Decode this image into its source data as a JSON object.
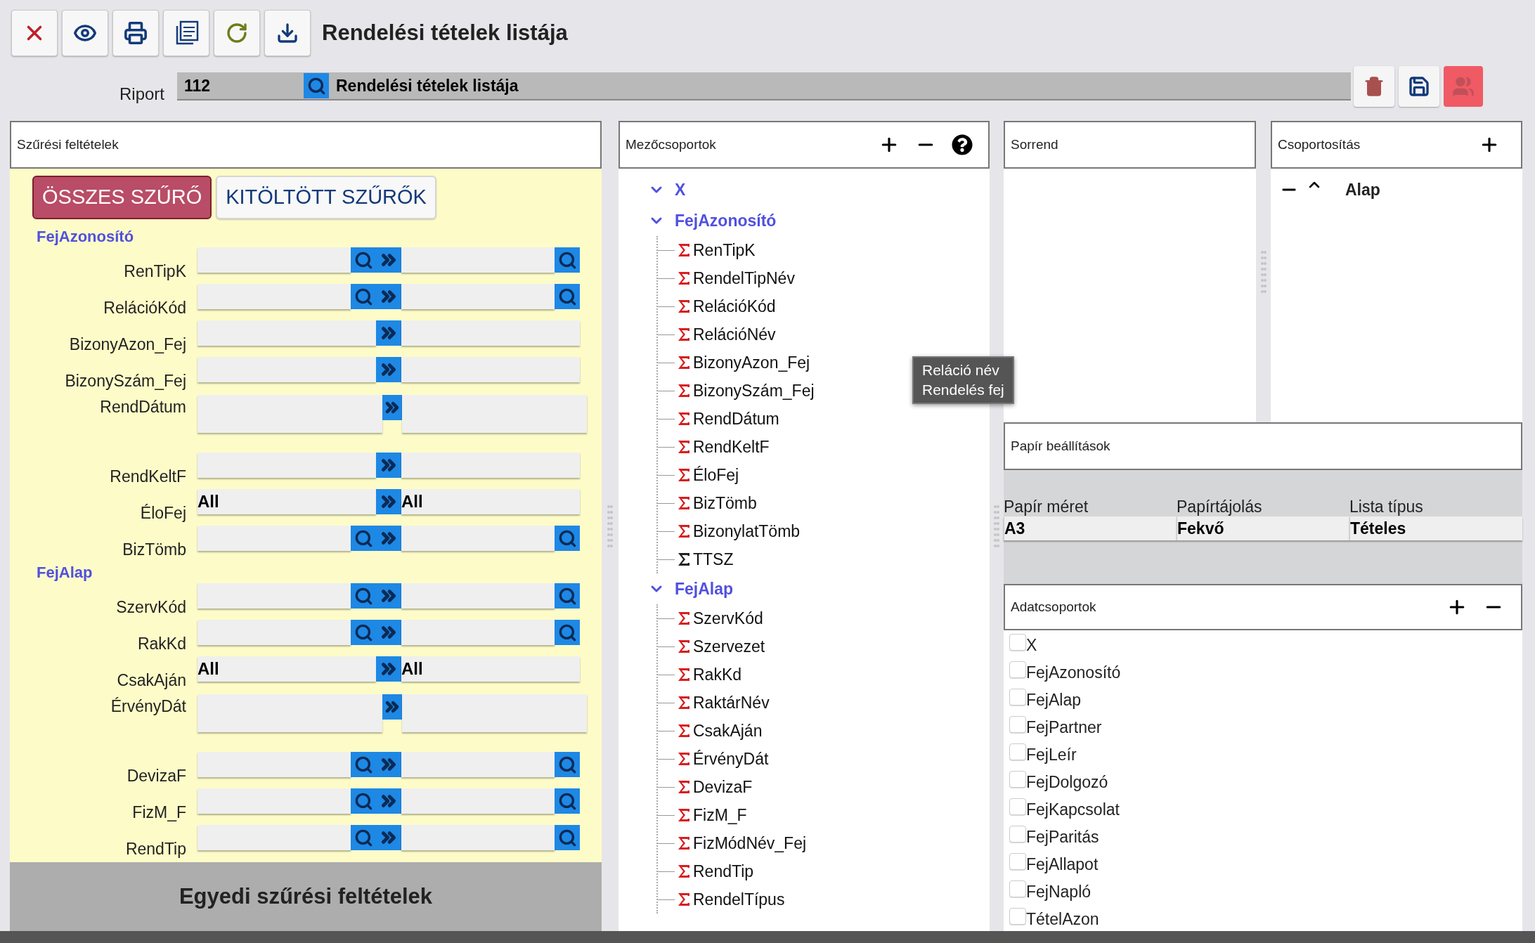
{
  "toolbar": {
    "title": "Rendelési tételek listája"
  },
  "report": {
    "label": "Riport",
    "code": "112",
    "name": "Rendelési tételek listája"
  },
  "filters": {
    "title": "Szűrési feltételek",
    "tabs": [
      {
        "label": "ÖSSZES SZŰRŐ",
        "selected": true
      },
      {
        "label": "KITÖLTÖTT SZŰRŐK",
        "selected": false
      }
    ],
    "groups": [
      {
        "name": "FejAzonosító",
        "rows": [
          {
            "label": "RenTipK",
            "kind": "lookup"
          },
          {
            "label": "RelációKód",
            "kind": "lookup"
          },
          {
            "label": "BizonyAzon_Fej",
            "kind": "plain"
          },
          {
            "label": "BizonySzám_Fej",
            "kind": "plain"
          },
          {
            "label": "RendDátum",
            "kind": "date"
          },
          {
            "label": "RendKeltF",
            "kind": "plain"
          },
          {
            "label": "ÉloFej",
            "kind": "select",
            "from": "All",
            "to": "All"
          },
          {
            "label": "BizTömb",
            "kind": "lookup"
          }
        ]
      },
      {
        "name": "FejAlap",
        "rows": [
          {
            "label": "SzervKód",
            "kind": "lookup"
          },
          {
            "label": "RakKd",
            "kind": "lookup"
          },
          {
            "label": "CsakAján",
            "kind": "select",
            "from": "All",
            "to": "All"
          },
          {
            "label": "ÉrvényDát",
            "kind": "date"
          },
          {
            "label": "DevizaF",
            "kind": "lookup"
          },
          {
            "label": "FizM_F",
            "kind": "lookup"
          },
          {
            "label": "RendTip",
            "kind": "lookup"
          }
        ]
      }
    ],
    "footer": "Egyedi szűrési feltételek"
  },
  "field_groups": {
    "title": "Mezőcsoportok",
    "groups": [
      {
        "name": "X",
        "expanded": true
      },
      {
        "name": "FejAzonosító",
        "expanded": true,
        "children": [
          {
            "name": "RenTipK",
            "color": "#d81e1e"
          },
          {
            "name": "RendelTipNév",
            "color": "#d81e1e"
          },
          {
            "name": "RelációKód",
            "color": "#d81e1e"
          },
          {
            "name": "RelációNév",
            "color": "#d81e1e"
          },
          {
            "name": "BizonyAzon_Fej",
            "color": "#d81e1e"
          },
          {
            "name": "BizonySzám_Fej",
            "color": "#d81e1e"
          },
          {
            "name": "RendDátum",
            "color": "#d81e1e"
          },
          {
            "name": "RendKeltF",
            "color": "#d81e1e"
          },
          {
            "name": "ÉloFej",
            "color": "#d81e1e"
          },
          {
            "name": "BizTömb",
            "color": "#d81e1e"
          },
          {
            "name": "BizonylatTömb",
            "color": "#d81e1e"
          },
          {
            "name": "TTSZ",
            "color": "#222222"
          }
        ]
      },
      {
        "name": "FejAlap",
        "expanded": true,
        "children": [
          {
            "name": "SzervKód",
            "color": "#d81e1e"
          },
          {
            "name": "Szervezet",
            "color": "#d81e1e"
          },
          {
            "name": "RakKd",
            "color": "#d81e1e"
          },
          {
            "name": "RaktárNév",
            "color": "#d81e1e"
          },
          {
            "name": "CsakAján",
            "color": "#d81e1e"
          },
          {
            "name": "ÉrvényDát",
            "color": "#d81e1e"
          },
          {
            "name": "DevizaF",
            "color": "#d81e1e"
          },
          {
            "name": "FizM_F",
            "color": "#d81e1e"
          },
          {
            "name": "FizMódNév_Fej",
            "color": "#d81e1e"
          },
          {
            "name": "RendTip",
            "color": "#d81e1e"
          },
          {
            "name": "RendelTípus",
            "color": "#d81e1e"
          }
        ]
      }
    ]
  },
  "tooltip": {
    "lines": [
      "Reláció név",
      "Rendelés fej"
    ]
  },
  "order": {
    "title": "Sorrend"
  },
  "grouping": {
    "title": "Csoportosítás",
    "items": [
      {
        "name": "Alap"
      }
    ]
  },
  "paper": {
    "title": "Papír beállítások",
    "fields": [
      {
        "label": "Papír méret",
        "value": "A3"
      },
      {
        "label": "Papírtájolás",
        "value": "Fekvő"
      },
      {
        "label": "Lista típus",
        "value": "Tételes"
      }
    ]
  },
  "data_groups": {
    "title": "Adatcsoportok",
    "items": [
      {
        "label": "X",
        "checked": false
      },
      {
        "label": "FejAzonosító",
        "checked": false
      },
      {
        "label": "FejAlap",
        "checked": false
      },
      {
        "label": "FejPartner",
        "checked": false
      },
      {
        "label": "FejLeír",
        "checked": false
      },
      {
        "label": "FejDolgozó",
        "checked": false
      },
      {
        "label": "FejKapcsolat",
        "checked": false
      },
      {
        "label": "FejParitás",
        "checked": false
      },
      {
        "label": "FejAllapot",
        "checked": false
      },
      {
        "label": "FejNapló",
        "checked": false
      },
      {
        "label": "TételAzon",
        "checked": false
      }
    ]
  }
}
